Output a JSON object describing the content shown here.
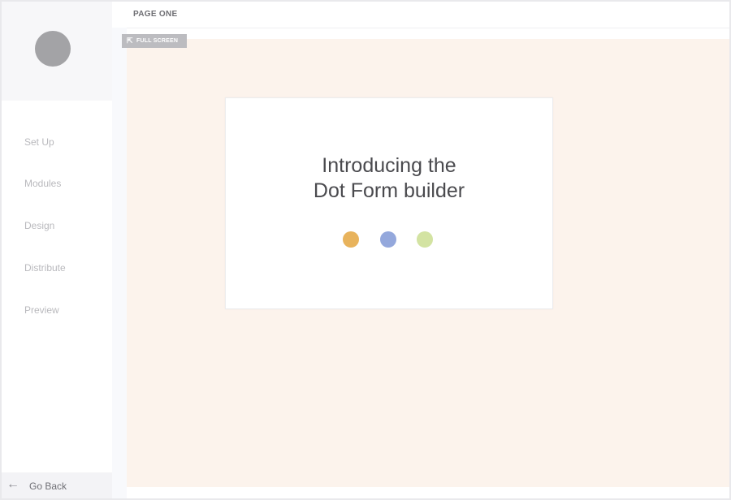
{
  "sidebar": {
    "items": [
      {
        "label": "Set Up"
      },
      {
        "label": "Modules"
      },
      {
        "label": "Design"
      },
      {
        "label": "Distribute"
      },
      {
        "label": "Preview"
      }
    ],
    "go_back_label": "Go Back",
    "back_icon": "arrow-left-icon"
  },
  "header": {
    "page_title": "PAGE ONE"
  },
  "canvas": {
    "fullscreen_label": "FULL SCREEN",
    "fullscreen_icon": "expand-arrow-icon",
    "background_color": "#fcf3ec",
    "card": {
      "title_line1": "Introducing the",
      "title_line2": "Dot Form builder",
      "dots": [
        {
          "color": "#e8b35c"
        },
        {
          "color": "#94a8dc"
        },
        {
          "color": "#d3e3a2"
        }
      ]
    }
  }
}
